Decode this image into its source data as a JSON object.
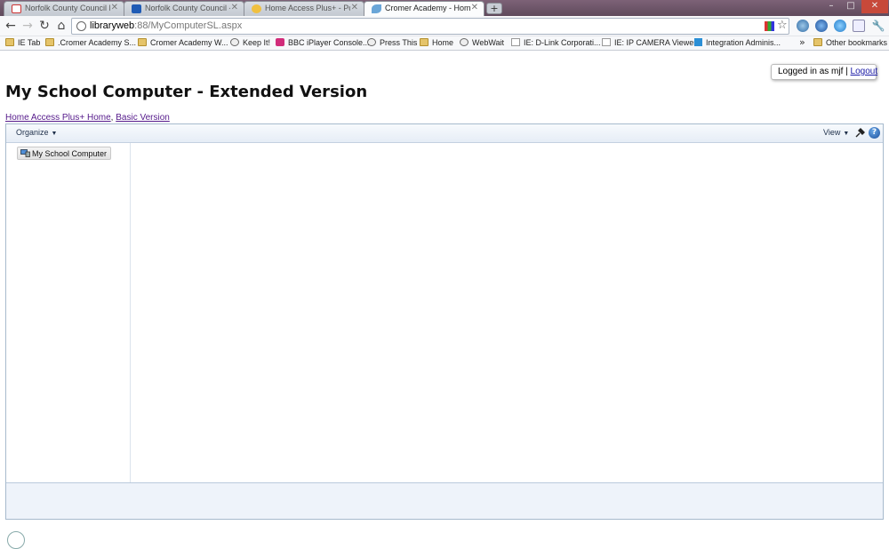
{
  "browser": {
    "tabs": [
      {
        "title": "Norfolk County Council Ma",
        "favicon": "gmail-icon",
        "active": false
      },
      {
        "title": "Norfolk County Council - C",
        "favicon": "calendar-icon",
        "active": false
      },
      {
        "title": "Home Access Plus+ - Post",
        "favicon": "forum-icon",
        "active": false
      },
      {
        "title": "Cromer Academy - Home",
        "favicon": "cromer-icon",
        "active": true
      }
    ],
    "new_tab": "+",
    "window_controls": {
      "minimize": "–",
      "maximize": "□",
      "close": "✕"
    },
    "address": {
      "host": "libraryweb",
      "path": ":88/MyComputerSL.aspx"
    },
    "bookmarks": [
      {
        "label": "IE Tab",
        "icon": "folder"
      },
      {
        "label": ".Cromer Academy S...",
        "icon": "folder"
      },
      {
        "label": "Cromer Academy W...",
        "icon": "folder"
      },
      {
        "label": "Keep It!",
        "icon": "globe"
      },
      {
        "label": "BBC iPlayer Console...",
        "icon": "pink"
      },
      {
        "label": "Press This",
        "icon": "globe"
      },
      {
        "label": "Home",
        "icon": "folder"
      },
      {
        "label": "WebWait",
        "icon": "globe"
      },
      {
        "label": "IE: D-Link Corporati...",
        "icon": "ie"
      },
      {
        "label": "IE: IP CAMERA Viewer",
        "icon": "ie"
      },
      {
        "label": "Integration Adminis...",
        "icon": "arrow"
      }
    ],
    "more_bookmarks": "»",
    "other_bookmarks": "Other bookmarks"
  },
  "page": {
    "login": {
      "prefix": "Logged in as mjf |",
      "logout": "Logout"
    },
    "title": "My School Computer - Extended Version",
    "links": {
      "home": "Home Access Plus+ Home",
      "separator": ",",
      "basic": "Basic Version"
    },
    "explorer": {
      "organize": "Organize",
      "view": "View",
      "help": "?",
      "tree_root": "My School Computer"
    }
  }
}
